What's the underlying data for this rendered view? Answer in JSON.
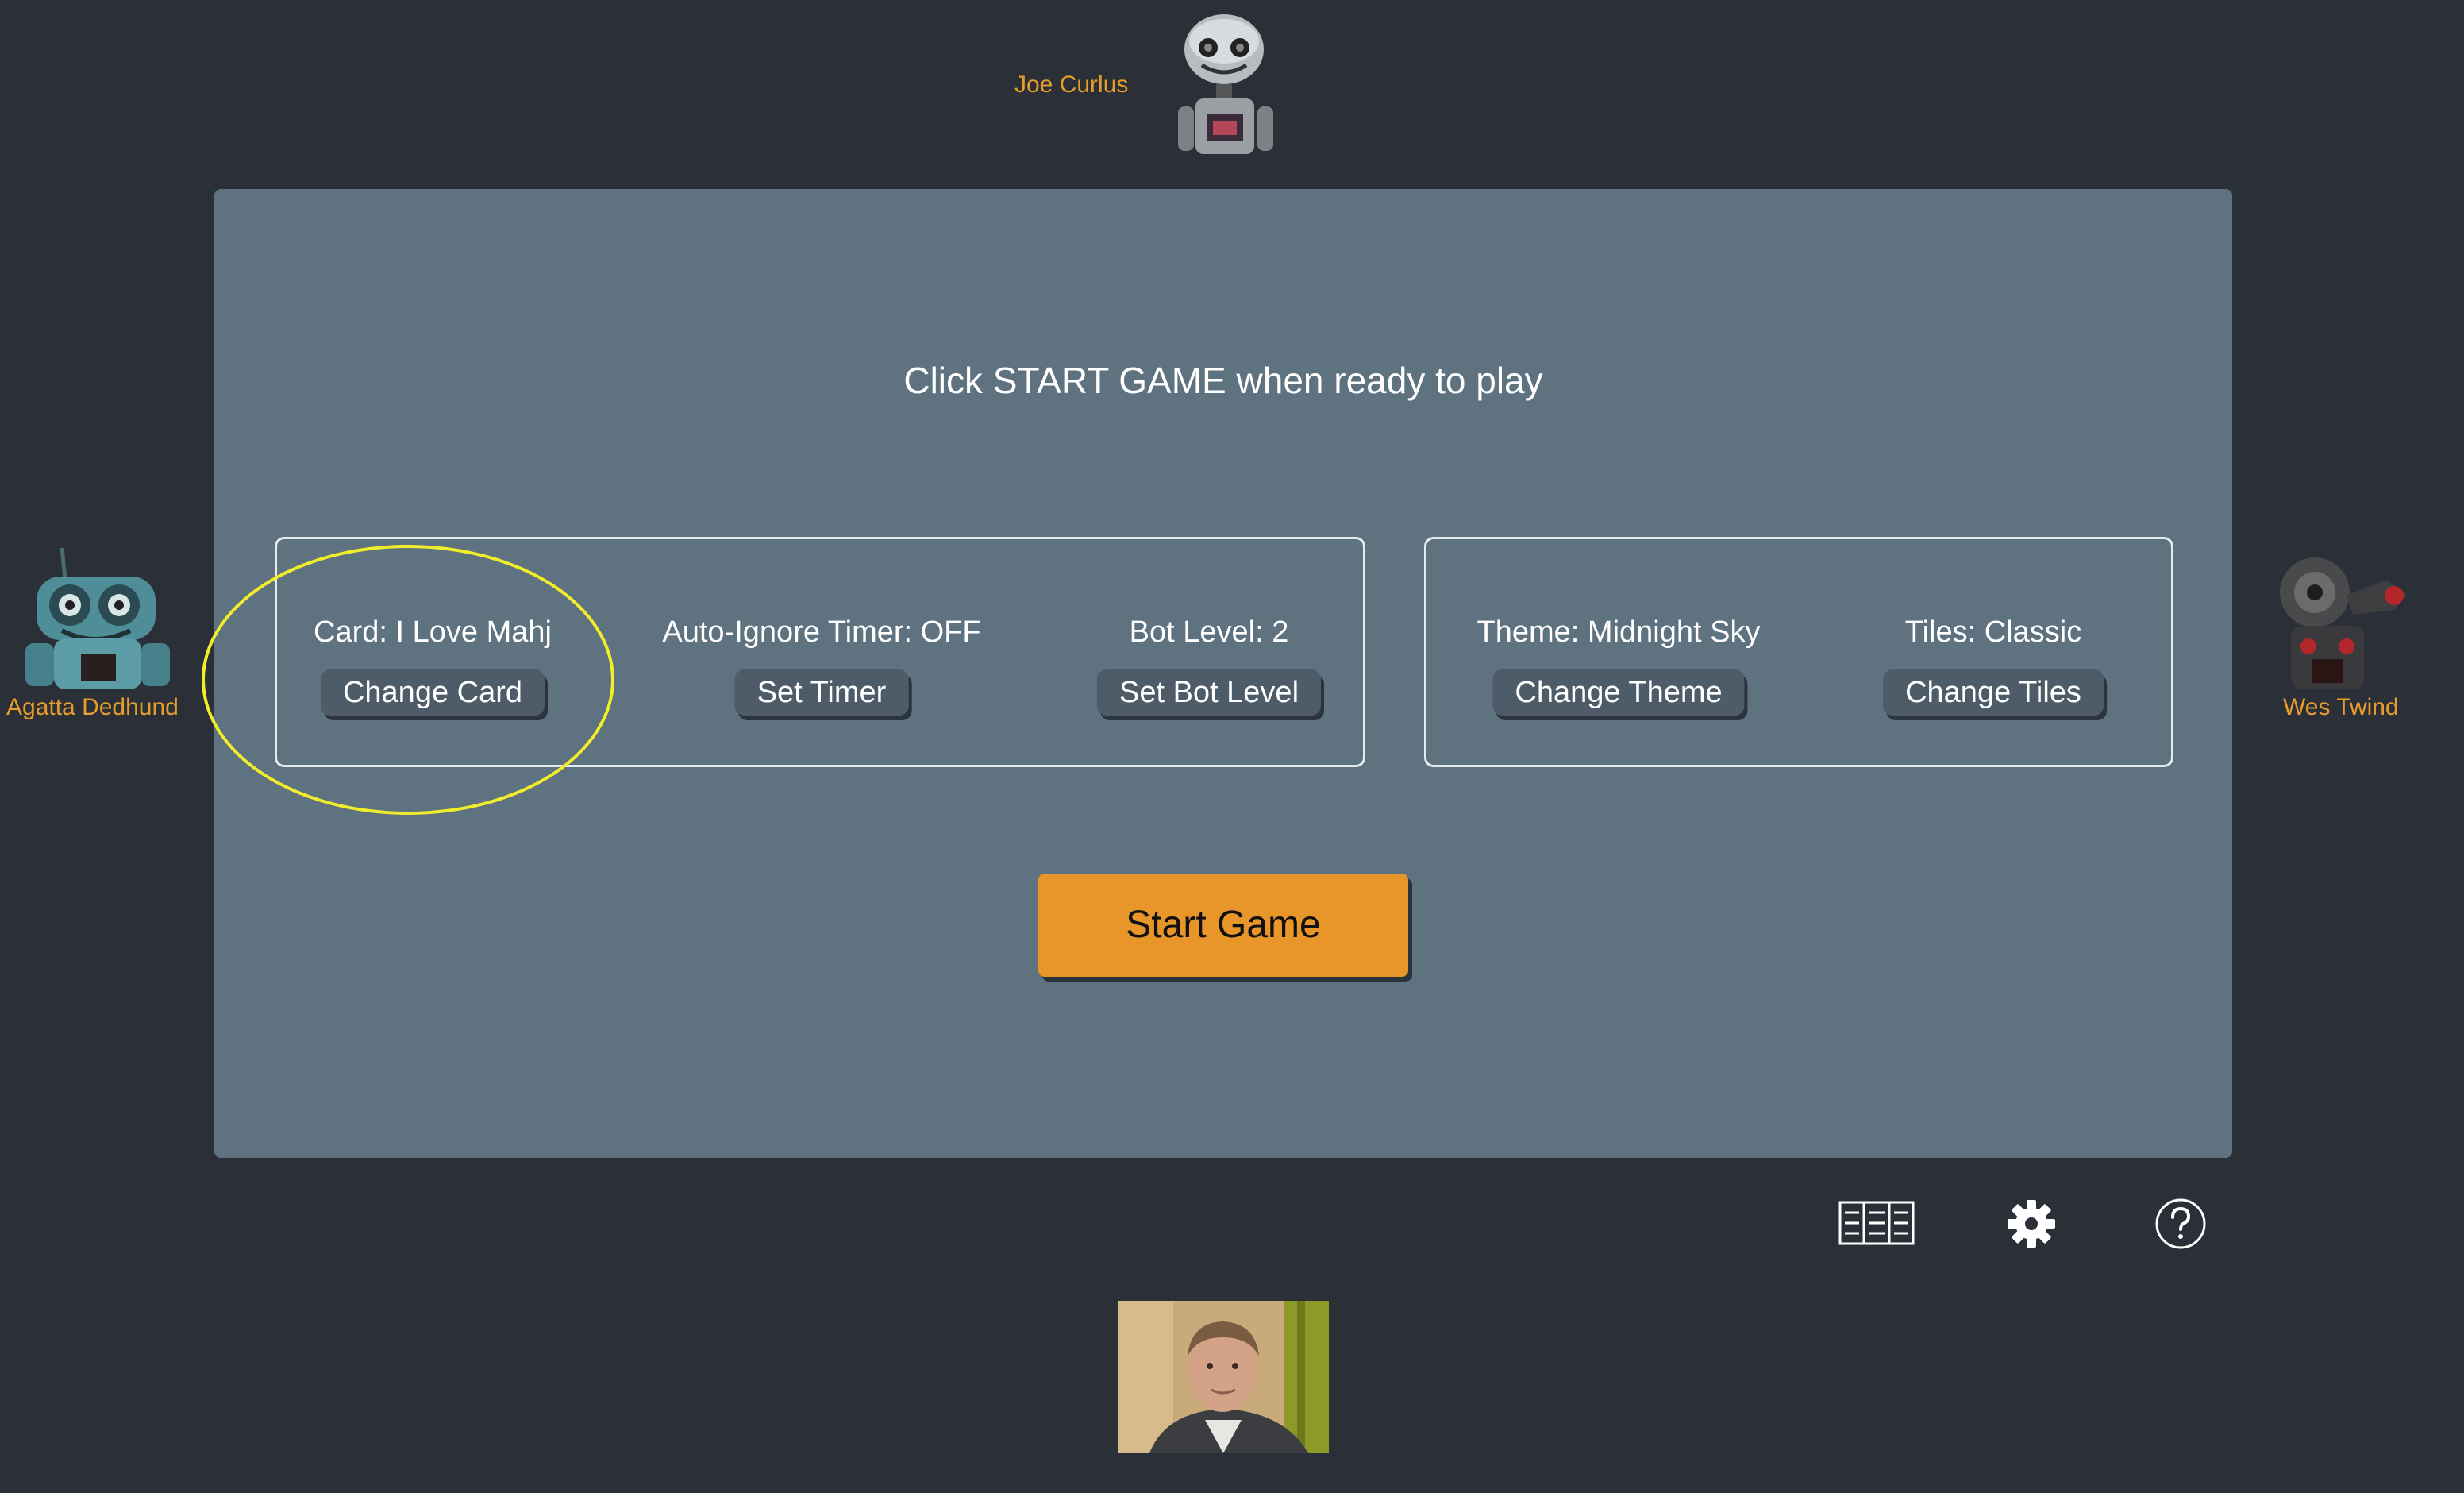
{
  "players": {
    "top": {
      "name": "Joe Curlus"
    },
    "left": {
      "name": "Agatta Dedhund"
    },
    "right": {
      "name": "Wes Twind"
    }
  },
  "panel": {
    "instruction": "Click START GAME when ready to play",
    "settings_left": [
      {
        "label": "Card: I Love Mahj",
        "button": "Change Card"
      },
      {
        "label": "Auto-Ignore Timer: OFF",
        "button": "Set Timer"
      },
      {
        "label": "Bot Level: 2",
        "button": "Set Bot Level"
      }
    ],
    "settings_right": [
      {
        "label": "Theme: Midnight Sky",
        "button": "Change Theme"
      },
      {
        "label": "Tiles: Classic",
        "button": "Change Tiles"
      }
    ],
    "start_button": "Start Game"
  },
  "toolbar": {
    "icons": [
      "card-icon",
      "gear-icon",
      "help-icon"
    ]
  },
  "colors": {
    "background": "#2a2f38",
    "panel": "#5f7280",
    "accent_orange": "#e8962a",
    "player_name": "#e79d2a",
    "highlight": "#f0ee2a"
  }
}
